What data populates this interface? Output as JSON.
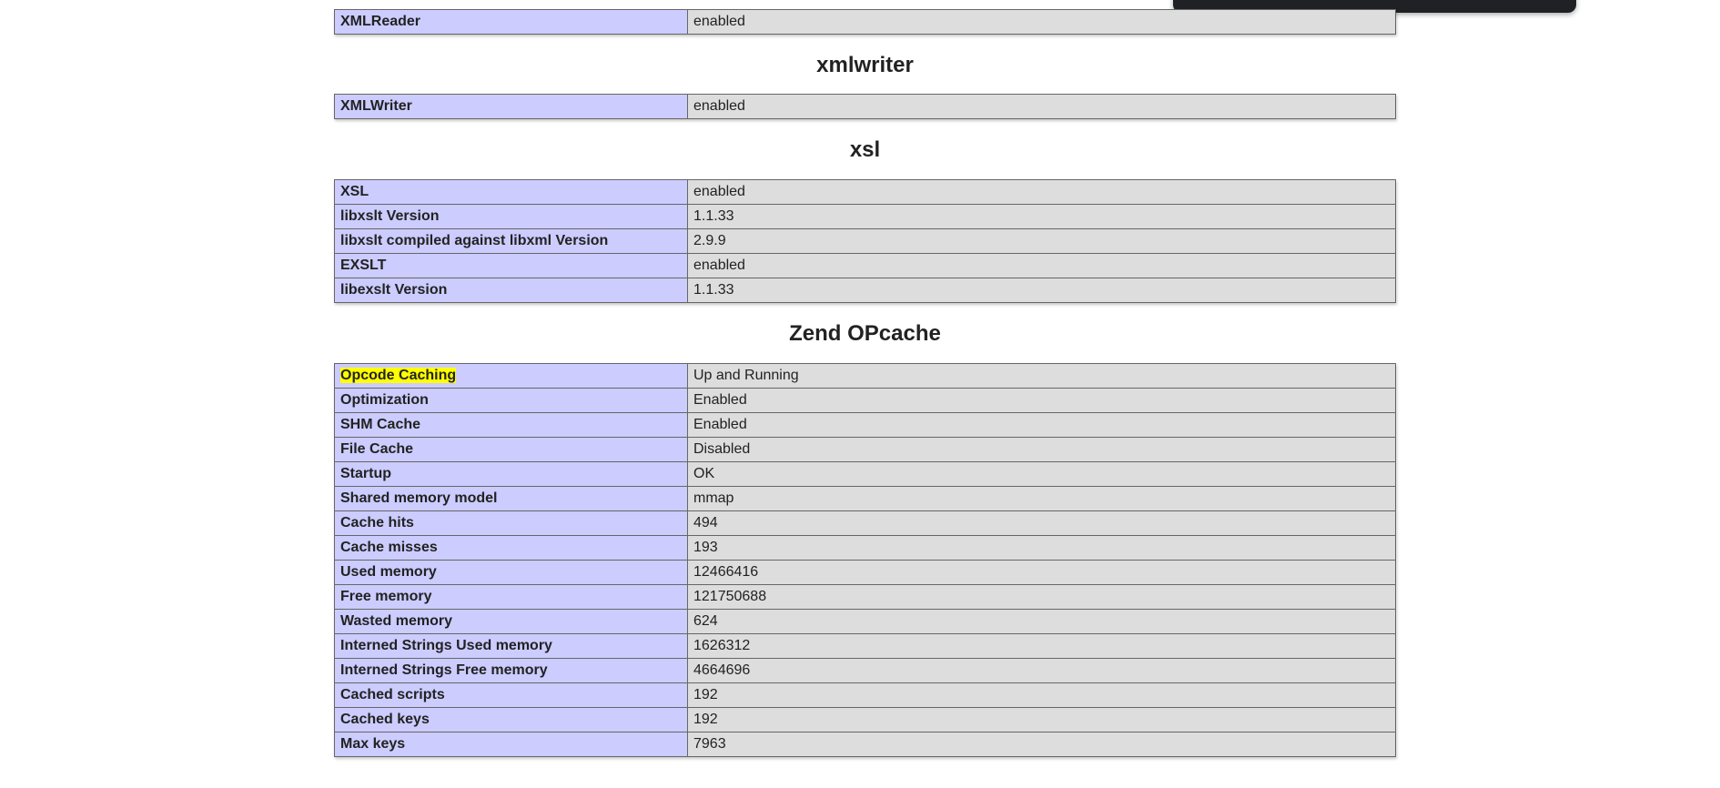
{
  "sections": {
    "xmlreader": {
      "rows": [
        {
          "key": "XMLReader",
          "value": "enabled"
        }
      ]
    },
    "xmlwriter": {
      "title": "xmlwriter",
      "rows": [
        {
          "key": "XMLWriter",
          "value": "enabled"
        }
      ]
    },
    "xsl": {
      "title": "xsl",
      "rows": [
        {
          "key": "XSL",
          "value": "enabled"
        },
        {
          "key": "libxslt Version",
          "value": "1.1.33"
        },
        {
          "key": "libxslt compiled against libxml Version",
          "value": "2.9.9"
        },
        {
          "key": "EXSLT",
          "value": "enabled"
        },
        {
          "key": "libexslt Version",
          "value": "1.1.33"
        }
      ]
    },
    "zend_opcache": {
      "title": "Zend OPcache",
      "rows": [
        {
          "key": "Opcode Caching",
          "value": "Up and Running"
        },
        {
          "key": "Optimization",
          "value": "Enabled"
        },
        {
          "key": "SHM Cache",
          "value": "Enabled"
        },
        {
          "key": "File Cache",
          "value": "Disabled"
        },
        {
          "key": "Startup",
          "value": "OK"
        },
        {
          "key": "Shared memory model",
          "value": "mmap"
        },
        {
          "key": "Cache hits",
          "value": "494"
        },
        {
          "key": "Cache misses",
          "value": "193"
        },
        {
          "key": "Used memory",
          "value": "12466416"
        },
        {
          "key": "Free memory",
          "value": "121750688"
        },
        {
          "key": "Wasted memory",
          "value": "624"
        },
        {
          "key": "Interned Strings Used memory",
          "value": "1626312"
        },
        {
          "key": "Interned Strings Free memory",
          "value": "4664696"
        },
        {
          "key": "Cached scripts",
          "value": "192"
        },
        {
          "key": "Cached keys",
          "value": "192"
        },
        {
          "key": "Max keys",
          "value": "7963"
        }
      ]
    }
  },
  "colors": {
    "key_cell_bg": "#ccccff",
    "value_cell_bg": "#dddddd",
    "highlight": "#ffff00",
    "popup_bg": "#202124"
  }
}
